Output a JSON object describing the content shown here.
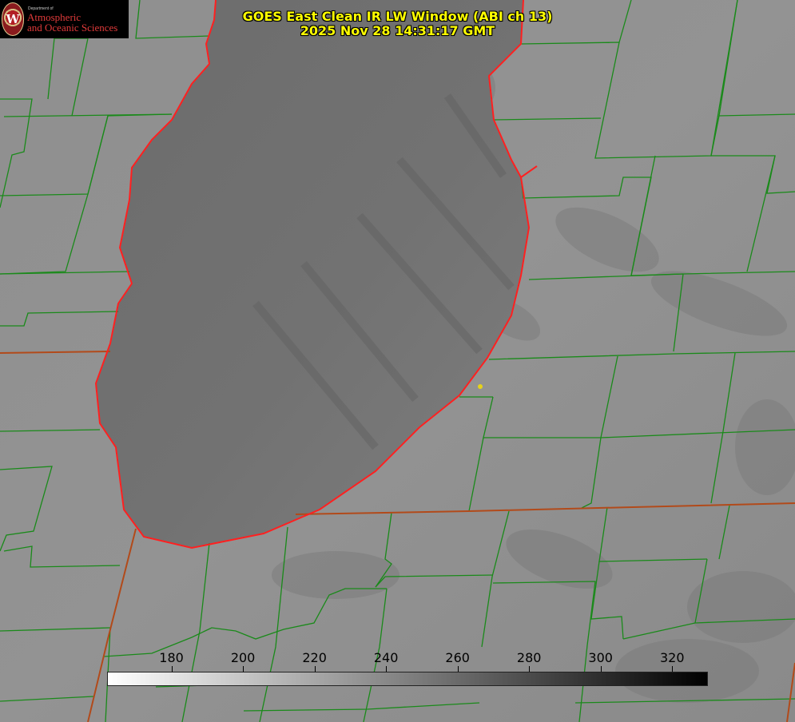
{
  "header": {
    "title_line1": "GOES East Clean IR LW Window (ABI ch 13)",
    "title_line2": "2025 Nov 28 14:31:17 GMT"
  },
  "logo": {
    "seal_letter": "W",
    "dept_text": "Department of",
    "line1": "Atmospheric",
    "line2": "and Oceanic Sciences"
  },
  "colorbar": {
    "min": 162,
    "max": 330,
    "ticks": [
      "180",
      "200",
      "220",
      "240",
      "260",
      "280",
      "300",
      "320"
    ],
    "tick_values": [
      180,
      200,
      220,
      240,
      260,
      280,
      300,
      320
    ],
    "start_color": "#ffffff",
    "end_color": "#000000"
  },
  "map": {
    "lake_shore_color": "#ff2020",
    "county_border_color": "#1a8a1a",
    "state_border_color": "#b24a1a",
    "marker_color": "#e6d21a"
  }
}
